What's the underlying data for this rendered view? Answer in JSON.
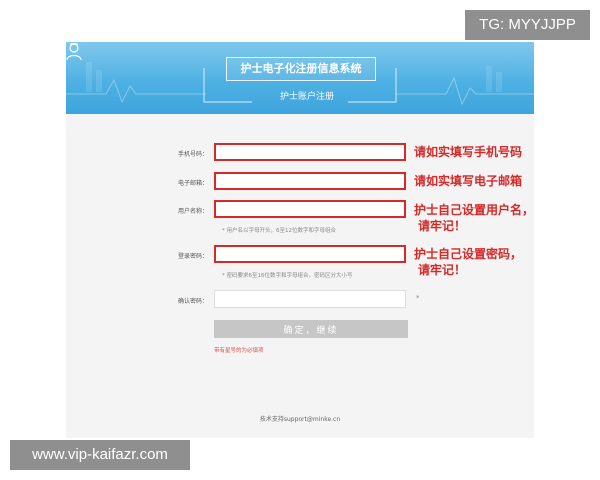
{
  "overlay": {
    "top_right_tag": "TG: MYYJJPP",
    "bottom_left_tag": "www.vip-kaifazr.com"
  },
  "header": {
    "title": "护士电子化注册信息系统",
    "subtitle": "护士账户注册",
    "icon": "nurse-icon"
  },
  "form": {
    "phone_label": "手机号码：",
    "email_label": "电子邮箱：",
    "username_label": "用户名称：",
    "username_hint": "* 用户名以字母开头，6至12位数字和字母组合",
    "password_label": "登录密码：",
    "password_hint": "* 密码要求6至16位数字和字母组合，密码区分大小写",
    "confirm_label": "确认密码：",
    "star": "*",
    "submit_label": "确定，继续",
    "required_note": "带有星号的为必填项"
  },
  "annotations": {
    "phone": "请如实填写手机号码",
    "email": "请如实填写电子邮箱",
    "username_line1": "护士自己设置用户名，",
    "username_line2": "请牢记！",
    "password_line1": "护士自己设置密码，",
    "password_line2": "请牢记！"
  },
  "footer": {
    "support": "技术支持support@minke.cn"
  },
  "colors": {
    "banner": "#4fb1e3",
    "highlight": "#d42a2a",
    "button": "#c6c6c6"
  }
}
